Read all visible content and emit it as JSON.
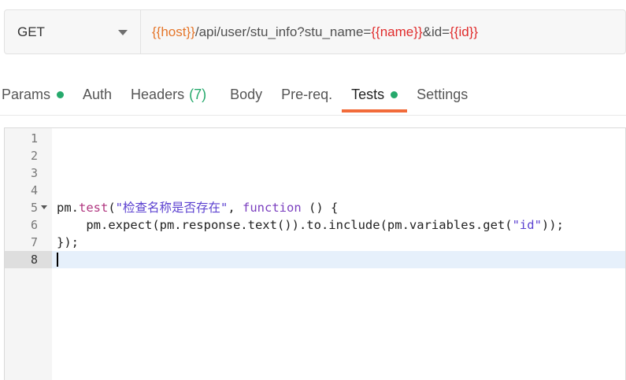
{
  "request": {
    "method": "GET",
    "url_parts": [
      {
        "text": "{{host}}",
        "kind": "var-ok"
      },
      {
        "text": "/api/user/stu_info?stu_name=",
        "kind": "plain"
      },
      {
        "text": "{{name}}",
        "kind": "var-bad"
      },
      {
        "text": "&id=",
        "kind": "plain"
      },
      {
        "text": "{{id}}",
        "kind": "var-bad"
      }
    ]
  },
  "tabs": {
    "params": "Params",
    "auth": "Auth",
    "headers": "Headers",
    "headers_count": "(7)",
    "body": "Body",
    "prereq": "Pre-req.",
    "tests": "Tests",
    "settings": "Settings",
    "active": "tests"
  },
  "editor": {
    "line_numbers": [
      "1",
      "2",
      "3",
      "4",
      "5",
      "6",
      "7",
      "8"
    ],
    "code": {
      "l5_a": "pm.",
      "l5_fn": "test",
      "l5_b": "(",
      "l5_str": "\"检查名称是否存在\"",
      "l5_c": ", ",
      "l5_kw": "function",
      "l5_d": " () {",
      "l6_a": "    pm.expect(pm.response.text()).to.include(pm.variables.get(",
      "l6_str": "\"id\"",
      "l6_b": "));",
      "l7": "});"
    },
    "active_line": "8"
  },
  "colors": {
    "accent_tab_underline": "#f26b3a",
    "status_dot": "#26a96c",
    "var_defined": "#e5762a",
    "var_undefined": "#e02c2c"
  }
}
